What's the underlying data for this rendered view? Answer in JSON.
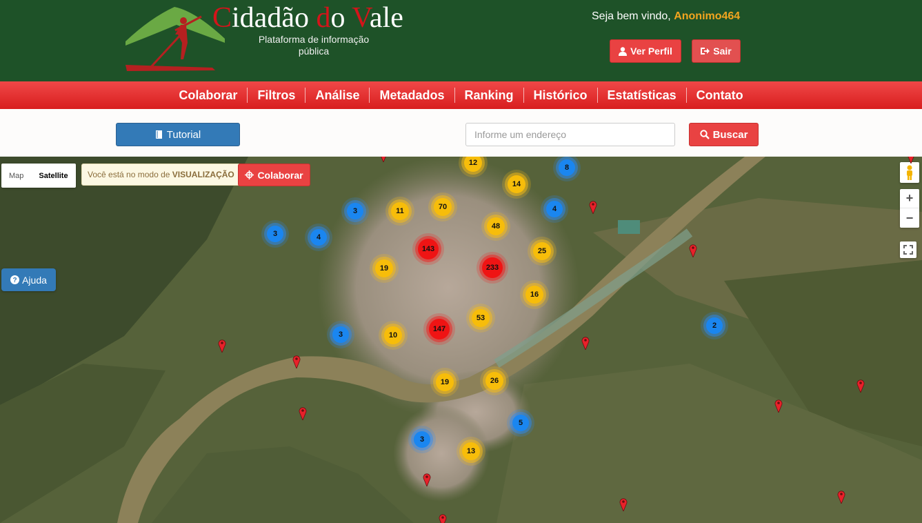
{
  "header": {
    "logo_title": "Cidadão do Vale",
    "logo_parts": [
      "C",
      "idadão ",
      "d",
      "o ",
      "V",
      "ale"
    ],
    "logo_subtitle": "Plataforma de informação pública",
    "welcome_text": "Seja bem vindo,",
    "username": "Anonimo464",
    "profile_button": "Ver Perfil",
    "logout_button": "Sair"
  },
  "nav": {
    "items": [
      "Colaborar",
      "Filtros",
      "Análise",
      "Metadados",
      "Ranking",
      "Histórico",
      "Estatísticas",
      "Contato"
    ]
  },
  "searchbar": {
    "tutorial_button": "Tutorial",
    "address_placeholder": "Informe um endereço",
    "search_button": "Buscar"
  },
  "map": {
    "maptype_map": "Map",
    "maptype_satellite": "Satellite",
    "maptype_active": "Satellite",
    "mode_prefix": "Você está no modo de",
    "mode_value": "VISUALIZAÇÃO",
    "colaborar_button": "Colaborar",
    "help_button": "Ajuda",
    "zoom_in": "+",
    "zoom_out": "−",
    "clusters": [
      {
        "label": "12",
        "color": "yellow"
      },
      {
        "label": "8",
        "color": "blue"
      },
      {
        "label": "14",
        "color": "yellow"
      },
      {
        "label": "3",
        "color": "blue"
      },
      {
        "label": "11",
        "color": "yellow"
      },
      {
        "label": "70",
        "color": "yellow"
      },
      {
        "label": "4",
        "color": "blue"
      },
      {
        "label": "48",
        "color": "yellow"
      },
      {
        "label": "3",
        "color": "blue"
      },
      {
        "label": "4",
        "color": "blue"
      },
      {
        "label": "143",
        "color": "red"
      },
      {
        "label": "25",
        "color": "yellow"
      },
      {
        "label": "19",
        "color": "yellow"
      },
      {
        "label": "233",
        "color": "red"
      },
      {
        "label": "16",
        "color": "yellow"
      },
      {
        "label": "53",
        "color": "yellow"
      },
      {
        "label": "2",
        "color": "blue"
      },
      {
        "label": "3",
        "color": "blue"
      },
      {
        "label": "10",
        "color": "yellow"
      },
      {
        "label": "147",
        "color": "red"
      },
      {
        "label": "19",
        "color": "yellow"
      },
      {
        "label": "26",
        "color": "yellow"
      },
      {
        "label": "5",
        "color": "blue"
      },
      {
        "label": "3",
        "color": "blue"
      },
      {
        "label": "13",
        "color": "yellow"
      }
    ],
    "single_marker_count": 14
  },
  "colors": {
    "header_bg": "#1e5228",
    "accent_red": "#e94242",
    "username": "#f2a51f",
    "tutorial_blue": "#337ab7"
  },
  "icons": [
    "user-icon",
    "sign-out-icon",
    "book-icon",
    "search-icon",
    "crosshair-icon",
    "question-circle-icon",
    "pegman-icon",
    "fullscreen-icon",
    "map-pin-icon"
  ]
}
